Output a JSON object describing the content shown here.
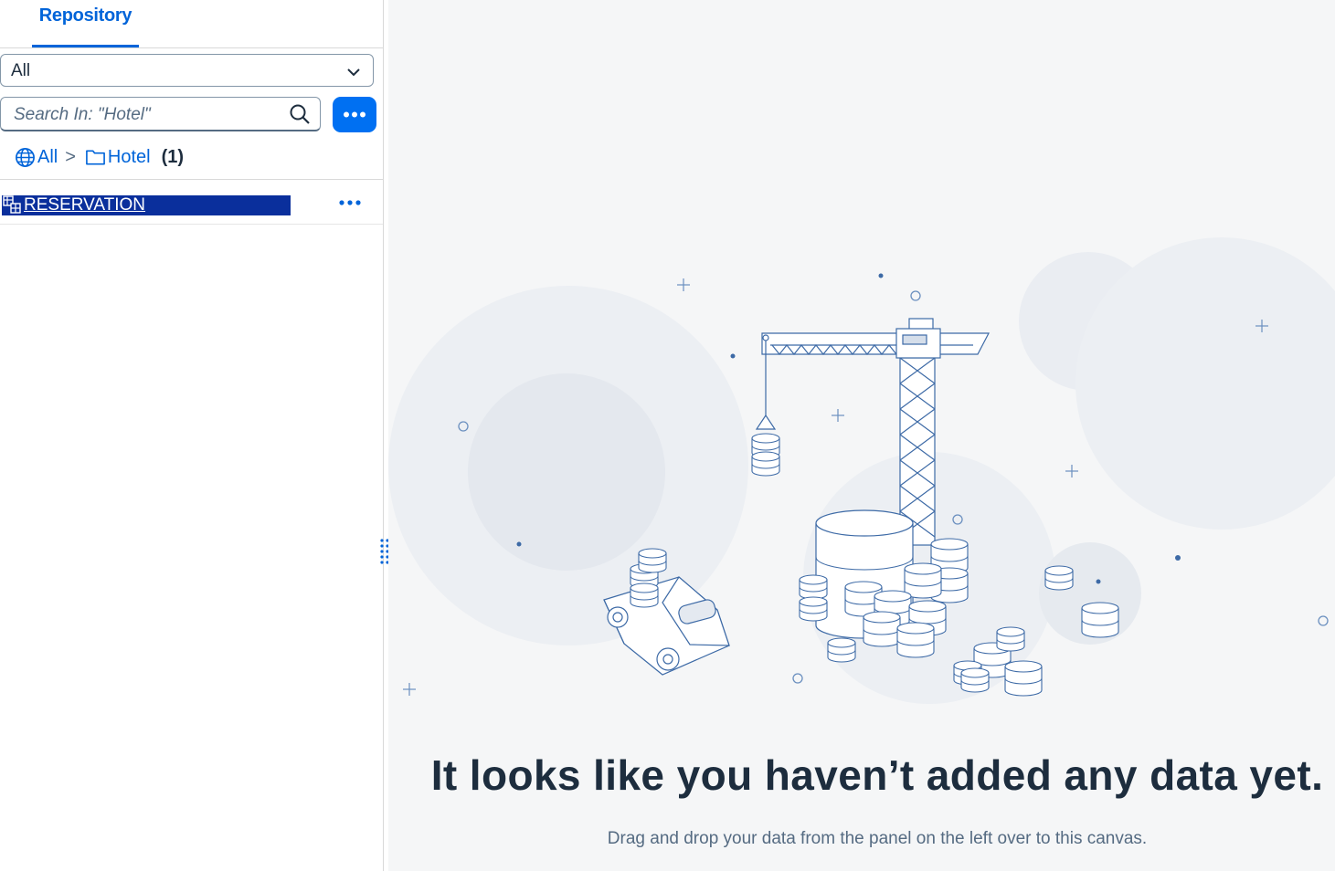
{
  "repository": {
    "tab_label": "Repository",
    "filter": {
      "selected": "All"
    },
    "search": {
      "placeholder": "Search In: \"Hotel\"",
      "value": ""
    },
    "breadcrumb": {
      "root": "All",
      "separator": ">",
      "folder": "Hotel",
      "count": "(1)"
    },
    "items": [
      {
        "name": "RESERVATION",
        "icon": "table-icon",
        "selected": true
      }
    ]
  },
  "canvas": {
    "empty_title": "It looks like you haven’t added any data yet.",
    "empty_description": "Drag and drop your data from the panel on the left over to this canvas."
  },
  "colors": {
    "accent": "#0070f2",
    "link": "#0064d9",
    "selection": "#0a2f9c",
    "canvas_bg": "#f5f6f7"
  }
}
